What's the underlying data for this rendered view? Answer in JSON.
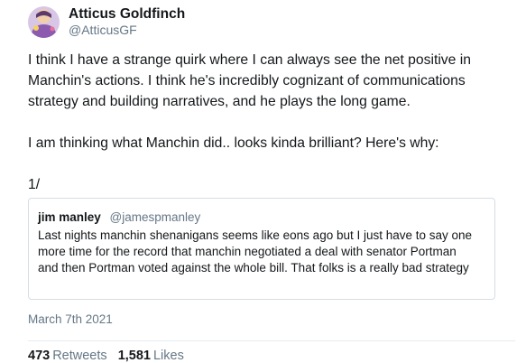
{
  "author": {
    "display_name": "Atticus Goldfinch",
    "handle": "@AtticusGF"
  },
  "tweet": {
    "paragraph_1": "I think I have a strange quirk where I can always see the net positive in Manchin's actions. I think he's incredibly cognizant of communications strategy and building narratives, and he plays the long game.",
    "paragraph_2": "I am thinking what Manchin did.. looks kinda brilliant? Here's why:",
    "paragraph_3": "1/"
  },
  "quoted_tweet": {
    "display_name": "jim manley",
    "handle": "@jamespmanley",
    "text": "Last nights manchin shenanigans seems like eons ago but I just have to say one more time for the record that manchin negotiated a deal with senator Portman and then Portman voted against the whole bill. That folks is a really bad strategy"
  },
  "meta": {
    "date": "March 7th 2021"
  },
  "stats": {
    "retweets_count": "473",
    "retweets_label": "Retweets",
    "likes_count": "1,581",
    "likes_label": "Likes"
  },
  "colors": {
    "text_primary": "#14171a",
    "text_secondary": "#657786",
    "border": "#d6dde3"
  }
}
